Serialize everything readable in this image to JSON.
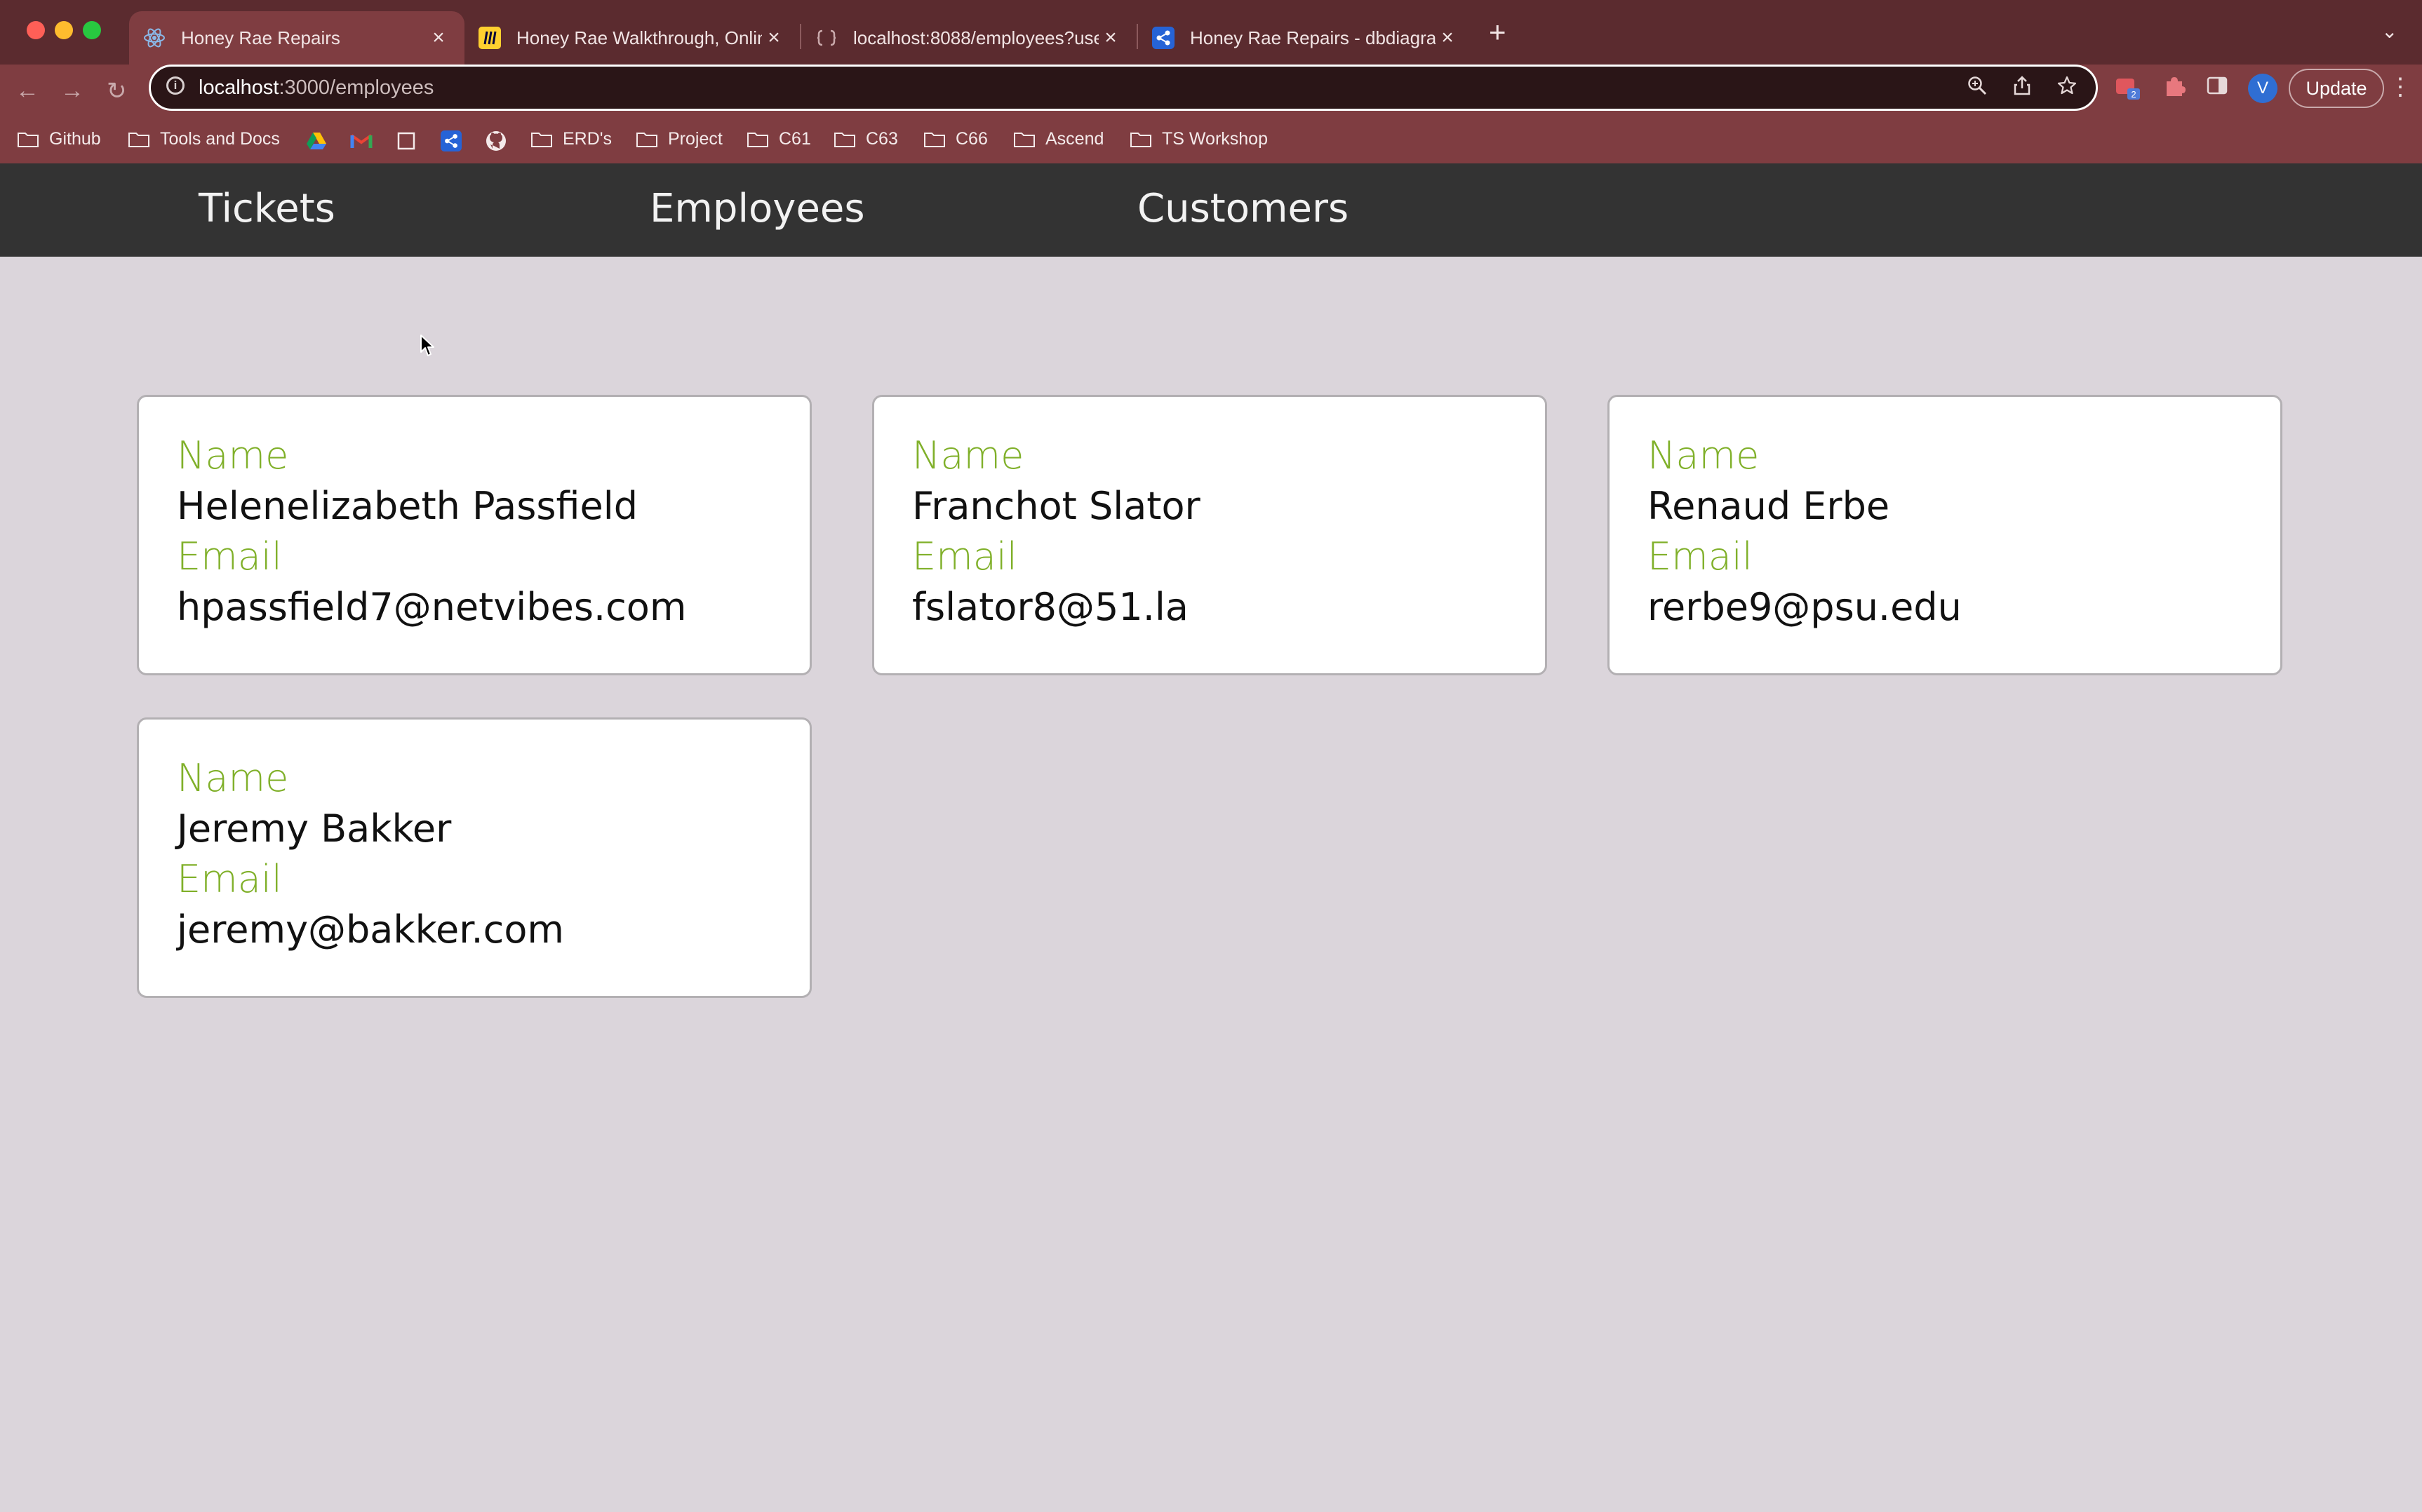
{
  "browser": {
    "tabs": [
      {
        "title": "Honey Rae Repairs",
        "active": true,
        "favicon": "react-icon"
      },
      {
        "title": "Honey Rae Walkthrough, Online",
        "active": false,
        "favicon": "miro-icon"
      },
      {
        "title": "localhost:8088/employees?use",
        "active": false,
        "favicon": "json-server-icon"
      },
      {
        "title": "Honey Rae Repairs - dbdiagram",
        "active": false,
        "favicon": "dbdiagram-icon"
      }
    ],
    "url_host": "localhost",
    "url_path": ":3000/employees",
    "profile_initial": "V",
    "update_label": "Update",
    "extension_badge": "2",
    "bookmarks": [
      "Github",
      "Tools and Docs",
      "ERD's",
      "Project",
      "C61",
      "C63",
      "C66",
      "Ascend",
      "TS Workshop"
    ]
  },
  "nav": {
    "links": [
      "Tickets",
      "Employees",
      "Customers"
    ]
  },
  "employees": [
    {
      "name_label": "Name",
      "name": "Helenelizabeth Passfield",
      "email_label": "Email",
      "email": "hpassfield7@netvibes.com"
    },
    {
      "name_label": "Name",
      "name": "Franchot Slator",
      "email_label": "Email",
      "email": "fslator8@51.la"
    },
    {
      "name_label": "Name",
      "name": "Renaud Erbe",
      "email_label": "Email",
      "email": "rerbe9@psu.edu"
    },
    {
      "name_label": "Name",
      "name": "Jeremy Bakker",
      "email_label": "Email",
      "email": "jeremy@bakker.com"
    }
  ],
  "colors": {
    "page_background": "#dbd5db",
    "navbar": "#333333",
    "label_green": "#80b02a",
    "browser_frame": "#7f3d41"
  }
}
